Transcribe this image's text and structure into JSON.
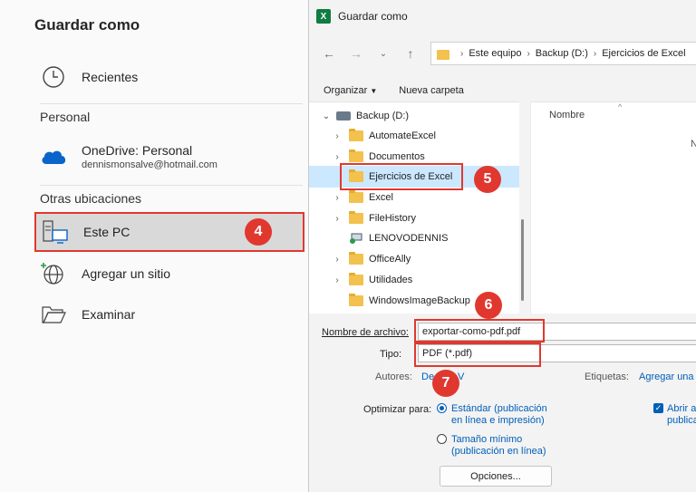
{
  "backstage": {
    "title": "Guardar como",
    "recientes": "Recientes",
    "section_personal": "Personal",
    "onedrive_name": "OneDrive: Personal",
    "onedrive_email": "dennismonsalve@hotmail.com",
    "section_otras": "Otras ubicaciones",
    "este_pc": "Este PC",
    "agregar_sitio": "Agregar un sitio",
    "examinar": "Examinar"
  },
  "badges": {
    "b4": "4",
    "b5": "5",
    "b6": "6",
    "b7": "7"
  },
  "dialog": {
    "window_title": "Guardar como",
    "excel_letter": "X",
    "breadcrumb": [
      "Este equipo",
      "Backup (D:)",
      "Ejercicios de Excel"
    ],
    "organizar": "Organizar",
    "nueva_carpeta": "Nueva carpeta",
    "tree": {
      "drive": "Backup (D:)",
      "items": [
        "AutomateExcel",
        "Documentos",
        "Ejercicios de Excel",
        "Excel",
        "FileHistory",
        "LENOVODENNIS",
        "OfficeAlly",
        "Utilidades",
        "WindowsImageBackup"
      ]
    },
    "column_nombre": "Nombre",
    "column_partial": "N",
    "nombre_label": "Nombre de archivo:",
    "nombre_value": "exportar-como-pdf.pdf",
    "tipo_label": "Tipo:",
    "tipo_value": "PDF (*.pdf)",
    "autores_label": "Autores:",
    "autores_value": "De",
    "autores_value_tail": "V",
    "etiquetas_label": "Etiquetas:",
    "etiquetas_value": "Agregar una",
    "optimizar_label": "Optimizar para:",
    "opt_estandar": "Estándar (publicación",
    "opt_estandar_2": "en línea e impresión)",
    "opt_minimo": "Tamaño mínimo",
    "opt_minimo_2": "(publicación en línea)",
    "abrir_1": "Abrir a",
    "abrir_2": "publica",
    "opciones": "Opciones..."
  }
}
